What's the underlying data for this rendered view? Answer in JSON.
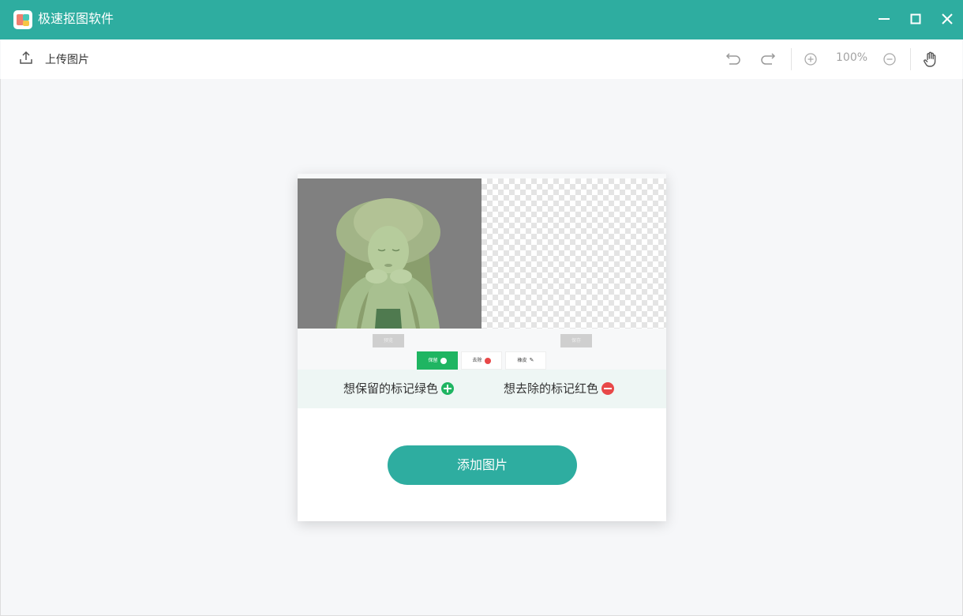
{
  "app": {
    "title": "极速抠图软件"
  },
  "toolbar": {
    "upload_label": "上传图片",
    "zoom": "100%"
  },
  "demo": {
    "left_button": "预览",
    "right_button": "保存",
    "tabs": [
      {
        "label": "保留"
      },
      {
        "label": "去除"
      },
      {
        "label": "橡皮"
      }
    ]
  },
  "hints": {
    "keep": "想保留的标记绿色",
    "remove": "想去除的标记红色"
  },
  "add_button": "添加图片",
  "colors": {
    "accent": "#2eada0",
    "keep": "#1fb562",
    "remove": "#e84848"
  }
}
